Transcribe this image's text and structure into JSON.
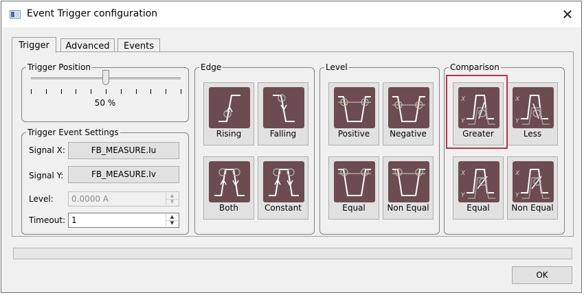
{
  "window": {
    "title": "Event Trigger configuration",
    "app_icon": "window-app-icon",
    "close_glyph": "✕"
  },
  "tabs": [
    {
      "label": "Trigger"
    },
    {
      "label": "Advanced"
    },
    {
      "label": "Events"
    }
  ],
  "trigger_position": {
    "title": "Trigger Position",
    "value_fraction": 0.5,
    "value_text": "50 %"
  },
  "trigger_event_settings": {
    "title": "Trigger Event Settings",
    "signal_x_label": "Signal X:",
    "signal_x_value": "FB_MEASURE.Iu",
    "signal_y_label": "Signal Y:",
    "signal_y_value": "FB_MEASURE.Iv",
    "level_label": "Level:",
    "level_value": "0.0000 A",
    "timeout_label": "Timeout:",
    "timeout_value": "1"
  },
  "edge": {
    "title": "Edge",
    "buttons": [
      {
        "label": "Rising"
      },
      {
        "label": "Falling"
      },
      {
        "label": "Both"
      },
      {
        "label": "Constant"
      }
    ]
  },
  "level": {
    "title": "Level",
    "buttons": [
      {
        "label": "Positive"
      },
      {
        "label": "Negative"
      },
      {
        "label": "Equal"
      },
      {
        "label": "Non Equal"
      }
    ]
  },
  "comparison": {
    "title": "Comparison",
    "selected": "Greater",
    "buttons": [
      {
        "label": "Greater"
      },
      {
        "label": "Less"
      },
      {
        "label": "Equal"
      },
      {
        "label": "Non Equal"
      }
    ]
  },
  "axis_letters": {
    "x": "X",
    "y": "Y"
  },
  "footer": {
    "ok_label": "OK"
  },
  "colors": {
    "icon_bg": "#6c4c50",
    "icon_line": "#ffffff",
    "selection_border": "#c0304a"
  }
}
